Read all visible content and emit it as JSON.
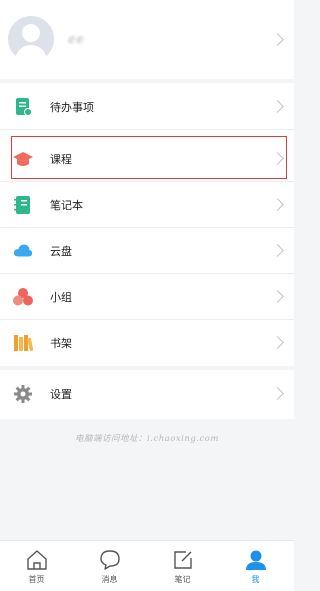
{
  "profile": {
    "username": "ⅇⅇ"
  },
  "menu": {
    "items": [
      {
        "label": "待办事项",
        "icon": "todo-icon",
        "color": "#2cb88b"
      },
      {
        "label": "课程",
        "icon": "course-cap-icon",
        "color": "#f06b5b"
      },
      {
        "label": "笔记本",
        "icon": "notebook-icon",
        "color": "#2cb88b"
      },
      {
        "label": "云盘",
        "icon": "cloud-icon",
        "color": "#3aa8f0"
      },
      {
        "label": "小组",
        "icon": "group-icon",
        "color": "#f0635b"
      },
      {
        "label": "书架",
        "icon": "bookshelf-icon",
        "color": "#f0a030"
      }
    ]
  },
  "settings": {
    "label": "设置",
    "icon": "gear-icon"
  },
  "footer": {
    "note": "电脑端访问地址：i.chaoxing.com"
  },
  "tabbar": {
    "tabs": [
      {
        "label": "首页",
        "icon": "home-icon"
      },
      {
        "label": "消息",
        "icon": "message-icon"
      },
      {
        "label": "笔记",
        "icon": "note-edit-icon"
      },
      {
        "label": "我",
        "icon": "profile-icon"
      }
    ],
    "active_index": 3,
    "accent": "#1e90f0"
  }
}
